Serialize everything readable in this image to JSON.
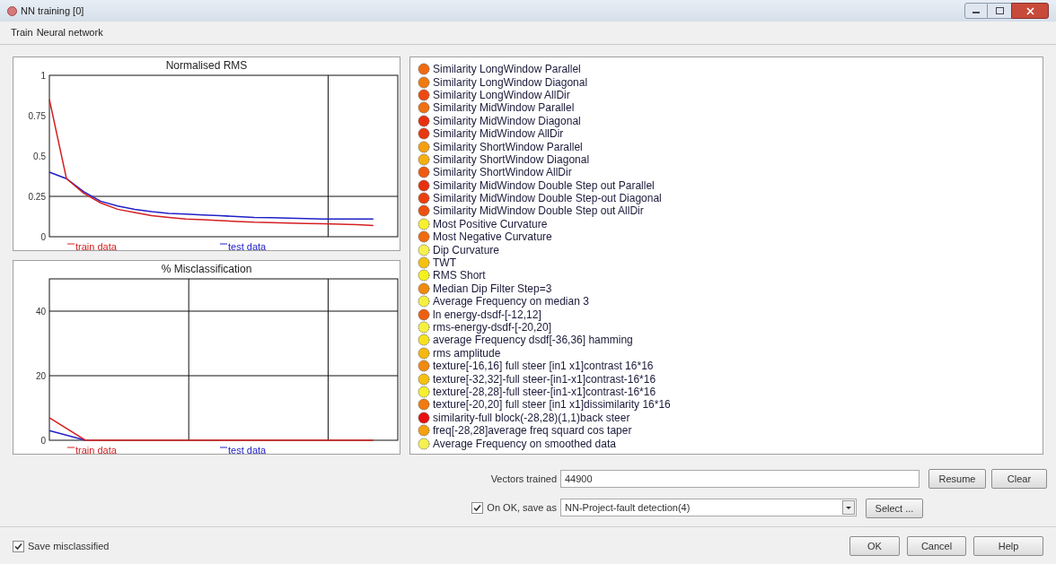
{
  "window": {
    "title": "NN training [0]"
  },
  "menu": [
    "Train",
    "Neural network"
  ],
  "charts": [
    {
      "chart_data": {
        "type": "line",
        "title": "Normalised RMS",
        "legend": "bottom",
        "categories": [
          null,
          null,
          null,
          null,
          null,
          null,
          null,
          null,
          null,
          null,
          null,
          null,
          null,
          null,
          null,
          null,
          null,
          null,
          null,
          null
        ],
        "ylim": [
          0,
          1
        ],
        "yticks": [
          0,
          {
            "value": 0.25,
            "label": "0.25"
          },
          {
            "value": 0.5,
            "label": "0.5"
          },
          {
            "value": 0.75,
            "label": "0.75"
          },
          1
        ],
        "series": [
          {
            "name": "train data",
            "color": "#d42020",
            "values": [
              0.85,
              0.36,
              0.27,
              0.21,
              0.17,
              0.15,
              0.13,
              0.12,
              0.11,
              0.105,
              0.1,
              0.095,
              0.09,
              0.088,
              0.085,
              0.082,
              0.08,
              0.077,
              0.075,
              0.07
            ]
          },
          {
            "name": "test data",
            "color": "#2020c8",
            "values": [
              0.4,
              0.36,
              0.28,
              0.22,
              0.19,
              0.17,
              0.155,
              0.145,
              0.14,
              0.135,
              0.13,
              0.125,
              0.12,
              0.118,
              0.115,
              0.113,
              0.11,
              0.11,
              0.11,
              0.11
            ]
          }
        ]
      }
    },
    {
      "chart_data": {
        "type": "line",
        "title": "% Misclassification",
        "legend": "bottom",
        "categories": [
          null,
          null,
          null,
          null,
          null,
          null,
          null,
          null,
          null,
          null
        ],
        "ylim": [
          0,
          50
        ],
        "yticks": [
          0,
          20,
          40
        ],
        "series": [
          {
            "name": "train data",
            "color": "#d42020",
            "values": [
              7,
              0,
              0,
              0,
              0,
              0,
              0,
              0,
              0,
              0
            ]
          },
          {
            "name": "test data",
            "color": "#2020c8",
            "values": [
              3,
              0,
              null,
              null,
              null,
              null,
              null,
              null,
              null,
              null
            ]
          }
        ]
      }
    }
  ],
  "attributes": [
    {
      "name": "Similarity LongWindow Parallel",
      "color": "#f06a10"
    },
    {
      "name": "Similarity LongWindow Diagonal",
      "color": "#f07a10"
    },
    {
      "name": "Similarity LongWindow AllDir",
      "color": "#ec4a10"
    },
    {
      "name": "Similarity MidWindow Parallel",
      "color": "#f07010"
    },
    {
      "name": "Similarity MidWindow Diagonal",
      "color": "#e83010"
    },
    {
      "name": "Similarity MidWindow AllDir",
      "color": "#e83810"
    },
    {
      "name": "Similarity ShortWindow Parallel",
      "color": "#f5a010"
    },
    {
      "name": "Similarity ShortWindow Diagonal",
      "color": "#f5b010"
    },
    {
      "name": "Similarity ShortWindow AllDir",
      "color": "#ee5a10"
    },
    {
      "name": "Similarity MidWindow Double Step out Parallel",
      "color": "#e83010"
    },
    {
      "name": "Similarity MidWindow Double Step-out Diagonal",
      "color": "#ea4010"
    },
    {
      "name": "Similarity MidWindow Double Step out AllDir",
      "color": "#ec5010"
    },
    {
      "name": "Most Positive Curvature",
      "color": "#f5f030"
    },
    {
      "name": "Most Negative Curvature",
      "color": "#f06a10"
    },
    {
      "name": "Dip Curvature",
      "color": "#f5f050"
    },
    {
      "name": "TWT",
      "color": "#f5c010"
    },
    {
      "name": "RMS Short",
      "color": "#f5f020"
    },
    {
      "name": "Median Dip Filter Step=3",
      "color": "#f08a10"
    },
    {
      "name": "Average Frequency on median 3",
      "color": "#f5f040"
    },
    {
      "name": "ln energy-dsdf-[-12,12]",
      "color": "#ee6010"
    },
    {
      "name": "rms-energy-dsdf-[-20,20]",
      "color": "#f5f040"
    },
    {
      "name": "average Frequency dsdf[-36,36] hamming",
      "color": "#f5e020"
    },
    {
      "name": "rms amplitude",
      "color": "#f5b810"
    },
    {
      "name": "texture[-16,16] full steer [in1 x1]contrast 16*16",
      "color": "#f08a10"
    },
    {
      "name": "texture[-32,32]-full steer-[in1-x1]contrast-16*16",
      "color": "#f5c010"
    },
    {
      "name": "texture[-28,28]-full steer-[in1-x1]contrast-16*16",
      "color": "#f5f030"
    },
    {
      "name": "texture[-20,20] full steer [in1 x1]dissimilarity 16*16",
      "color": "#f07a10"
    },
    {
      "name": "similarity-full block(-28,28)(1,1)back steer",
      "color": "#e81010"
    },
    {
      "name": "freq[-28,28]average freq squard cos taper",
      "color": "#f5a010"
    },
    {
      "name": "Average Frequency on smoothed data",
      "color": "#f5f050"
    }
  ],
  "vectors": {
    "label": "Vectors trained",
    "value": "44900",
    "buttons": [
      "Resume",
      "Clear"
    ]
  },
  "save_as": {
    "label": "On OK, save as",
    "checked": true,
    "value": "NN-Project-fault detection(4)",
    "button": "Select ..."
  },
  "save_misclassified": {
    "label": "Save misclassified",
    "checked": true
  },
  "buttons": [
    "OK",
    "Cancel",
    "Help"
  ]
}
